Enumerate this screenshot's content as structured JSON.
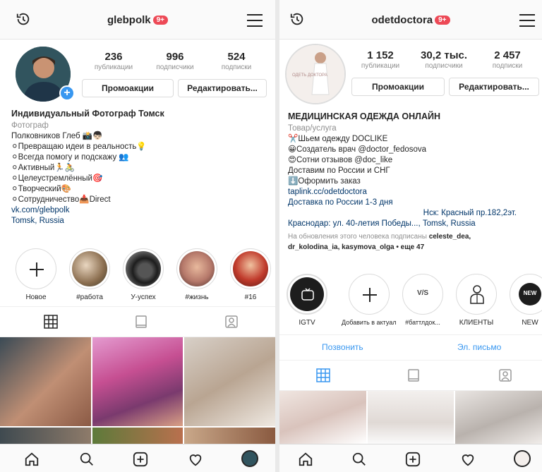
{
  "left": {
    "username": "glebpolk",
    "badge": "9+",
    "stats": [
      {
        "num": "236",
        "label": "публикации"
      },
      {
        "num": "996",
        "label": "подписчики"
      },
      {
        "num": "524",
        "label": "подписки"
      }
    ],
    "buttons": {
      "promo": "Промоакции",
      "edit": "Редактировать..."
    },
    "bio": {
      "name": "Индивидуальный Фотограф Томск",
      "category": "Фотограф",
      "lines": [
        "Полковников Глеб 📸👦🏻",
        "⚪Превращаю идеи в реальность💡",
        "⚪Всегда помогу и подскажу 👥",
        "⚪Активный🏃🚴",
        "⚪Целеустремлённый🎯",
        "⚪Творческий🎨",
        "⚪Сотрудничество📥Direct"
      ],
      "link": "vk.com/glebpolk",
      "location": "Tomsk, Russia"
    },
    "stories": [
      {
        "label": "Новое"
      },
      {
        "label": "#работа"
      },
      {
        "label": "У-успех"
      },
      {
        "label": "#жизнь"
      },
      {
        "label": "#16"
      }
    ]
  },
  "right": {
    "username": "odetdoctora",
    "badge": "9+",
    "stats": [
      {
        "num": "1 152",
        "label": "публикации"
      },
      {
        "num": "30,2 тыс.",
        "label": "подписчики"
      },
      {
        "num": "2 457",
        "label": "подписки"
      }
    ],
    "buttons": {
      "promo": "Промоакции",
      "edit": "Редактировать..."
    },
    "bio": {
      "name": "МЕДИЦИНСКАЯ ОДЕЖДА ОНЛАЙН",
      "category": "Товар/услуга",
      "lines": [
        "✂️Шьем одежду DOCLIKE",
        "😀Создатель врач @doctor_fedosova",
        "😍Сотни отзывов @doc_like",
        "Доставим по России и СНГ",
        "⬇️Оформить заказ"
      ],
      "link1": "taplink.cc/odetdoctora",
      "link2": "Доставка по России 1-3 дня",
      "addr1": "Нск: Красный пр.182,2эт.",
      "addr2": "Краснодар: ул. 40-летия Победы..., Tomsk, Russia",
      "followed_prefix": "На обновления этого человека подписаны",
      "followed_names": "celeste_dea,",
      "followed_names2": "dr_kolodina_ia, kasymova_olga",
      "followed_more": "• еще 47"
    },
    "stories": [
      {
        "label": "IGTV"
      },
      {
        "label": "Добавить в актуальное"
      },
      {
        "label": "#баттлдок..."
      },
      {
        "label": "КЛИЕНТЫ"
      },
      {
        "label": "NEW"
      }
    ],
    "story_texts": {
      "vs": "V/S",
      "new": "NEW"
    },
    "actions": {
      "call": "Позвонить",
      "email": "Эл. письмо"
    }
  },
  "colors": {
    "accent": "#3897f0",
    "badge": "#ed4956",
    "link": "#003569"
  }
}
